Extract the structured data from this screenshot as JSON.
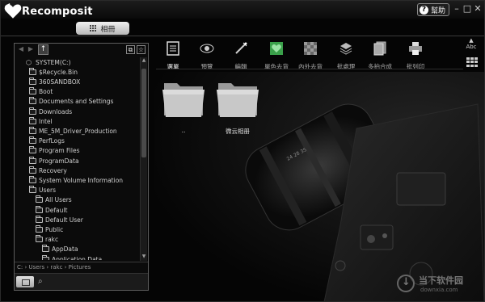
{
  "app": {
    "title": "Recomposit",
    "help_label": "幫助",
    "album_tab": "相冊"
  },
  "window_buttons": [
    "–",
    "□",
    "✕"
  ],
  "left_panel": {
    "tree": [
      {
        "label": "SYSTEM(C:)",
        "type": "drive",
        "level": 0
      },
      {
        "label": "$Recycle.Bin",
        "type": "folder",
        "level": 1
      },
      {
        "label": "360SANDBOX",
        "type": "folder",
        "level": 1
      },
      {
        "label": "Boot",
        "type": "folder",
        "level": 1
      },
      {
        "label": "Documents and Settings",
        "type": "folder",
        "level": 1
      },
      {
        "label": "Downloads",
        "type": "folder",
        "level": 1
      },
      {
        "label": "Intel",
        "type": "folder",
        "level": 1
      },
      {
        "label": "ME_5M_Driver_Production",
        "type": "folder",
        "level": 1
      },
      {
        "label": "PerfLogs",
        "type": "folder",
        "level": 1
      },
      {
        "label": "Program Files",
        "type": "folder",
        "level": 1
      },
      {
        "label": "ProgramData",
        "type": "folder",
        "level": 1
      },
      {
        "label": "Recovery",
        "type": "folder",
        "level": 1
      },
      {
        "label": "System Volume Information",
        "type": "folder",
        "level": 1
      },
      {
        "label": "Users",
        "type": "folder",
        "level": 1
      },
      {
        "label": "All Users",
        "type": "folder",
        "level": 2
      },
      {
        "label": "Default",
        "type": "folder",
        "level": 2
      },
      {
        "label": "Default User",
        "type": "folder",
        "level": 2
      },
      {
        "label": "Public",
        "type": "folder",
        "level": 2
      },
      {
        "label": "rakc",
        "type": "folder",
        "level": 2
      },
      {
        "label": "AppData",
        "type": "folder",
        "level": 3
      },
      {
        "label": "Application Data",
        "type": "folder",
        "level": 3
      }
    ],
    "path": "C: › Users › rakc › Pictures"
  },
  "toolbar": {
    "tools": [
      {
        "label": "選單",
        "icon": "list-icon",
        "active": true
      },
      {
        "label": "預覽",
        "icon": "eye-icon",
        "active": false
      },
      {
        "label": "編輯",
        "icon": "edit-wand-icon",
        "active": false
      },
      {
        "label": "單色去背",
        "icon": "heart-green-icon",
        "active": false
      },
      {
        "label": "內外去背",
        "icon": "checker-icon",
        "active": false
      },
      {
        "label": "批處理",
        "icon": "layers-icon",
        "active": false
      },
      {
        "label": "多拍合成",
        "icon": "stack-icon",
        "active": false
      },
      {
        "label": "批列印",
        "icon": "printer-icon",
        "active": false
      }
    ],
    "sort_label": "Abc"
  },
  "content": {
    "folders": [
      {
        "label": ".."
      },
      {
        "label": "微云相册"
      }
    ]
  },
  "watermark": {
    "title": "当下软件园",
    "subtitle": "downxia.com"
  },
  "colors": {
    "background": "#050505",
    "panel_border": "#5c5c5c",
    "accent_green": "#3aa04a"
  }
}
